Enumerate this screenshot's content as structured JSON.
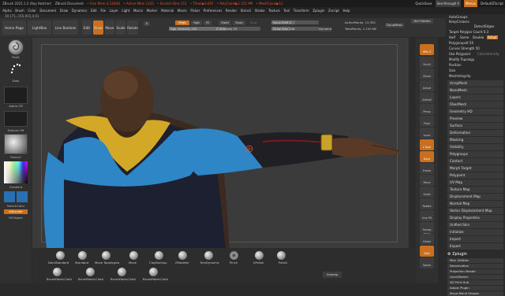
{
  "titlebar": {
    "app": "ZBrush 2021.1.2 (Ray Hatcher)",
    "doc": "ZBrush Document",
    "free_mem": "• Free Mem 4,316GB",
    "active_mem": "• Active Mem 1333",
    "scratch": "• Scratch Disk 211",
    "timer": "• Timer▶0.001",
    "polycount": "• PolyCount▶1.151 MP",
    "meshcount": "• MeshCount▶11",
    "quicksave": "QuickSave",
    "seethrough": "See-through 0",
    "menus": "Menus",
    "script": "DefaultZScript"
  },
  "menubar": [
    "Alpha",
    "Brush",
    "Color",
    "Document",
    "Draw",
    "Dynamics",
    "Edit",
    "File",
    "Layer",
    "Light",
    "Macro",
    "Marker",
    "Material",
    "Movie",
    "Picker",
    "Preferences",
    "Render",
    "Stencil",
    "Stroke",
    "Texture",
    "Tool",
    "Transform",
    "Zplugin",
    "Zscript",
    "Help"
  ],
  "coords": "39.171,-155.915,4.01",
  "toolbar": {
    "home_page": "Home Page",
    "lightbox": "LightBox",
    "live_boolean": "Live Boolean",
    "edit": "Edit",
    "draw": "Draw",
    "move": "Move",
    "scale": "Scale",
    "rotate": "Rotate",
    "a_label": "A",
    "mrgb": "Mrgb",
    "rgb": "Rgb",
    "m": "M",
    "zadd": "Zadd",
    "zsub": "Zsub",
    "zcut": "Zcut",
    "rgb_intensity": "Rgb Intensity 100",
    "z_intensity": "Z Intensity 25",
    "focal_shift": "Focal Shift 0",
    "draw_size": "Draw Size 146",
    "dynamic": "Dynamic",
    "active_points": "ActivePoints: 13,392",
    "total_points": "TotalPoints: 1.150 Mil",
    "dynamesh": "DynaMesh",
    "del_hidden": "Del Hidden"
  },
  "left_shelf": {
    "paint_label": "Paint",
    "dots_label": "Dots",
    "alpha": "Alpha Off",
    "texture": "Texture Off",
    "material": "Fibers2",
    "gradient": "Gradient",
    "switch_color": "SwitchColor",
    "alternate": "Alternate",
    "fill_object": "FillObject"
  },
  "right_shelf": [
    "SPix 3",
    "Scroll",
    "Zoom",
    "Actual",
    "AAHalf",
    "Persp",
    "Floor",
    "Local",
    "L.Sym",
    "Gxyz",
    "Frame",
    "Move",
    "Scale",
    "Rotate",
    "Line Fill PolyF",
    "Transp",
    "Ghost",
    "Solo",
    "Xpose"
  ],
  "right_panel": {
    "top_items": [
      "AutoGroups",
      "KeepCreases",
      "DetectEdges",
      "Target Polygon Count 0.3",
      "Half",
      "Same",
      "Double",
      "Adapt",
      "PolygroupsIt 50",
      "Curves Strength 50",
      "Use Polypaint",
      "ColorIntensity",
      "Modify Topology",
      "Position",
      "Size",
      "MeshIntegrity"
    ],
    "groups": [
      "ArrayMesh",
      "NanoMesh",
      "Layers",
      "FiberMesh",
      "Geometry HD",
      "Preview",
      "Surface",
      "Deformation",
      "Masking",
      "Visibility",
      "Polygroups",
      "Contact",
      "Morph Target",
      "Polypaint",
      "UV Map",
      "Texture Map",
      "Displacement Map",
      "Normal Map",
      "Vector Displacement Map",
      "Display Properties",
      "Unified Skin",
      "Initialize",
      "Import",
      "Export"
    ],
    "zplugin": "Zplugin",
    "plugins": [
      "Misc Utilities",
      "Deactivation",
      "Projection Master",
      "QuickSketch",
      "3D Print Hub",
      "Adjust Plugin",
      "Maya Blend Shapes"
    ]
  },
  "bottom_shelf": {
    "brushes_row1": [
      "DamStandard",
      "Standard",
      "Move Topologica",
      "Move",
      "ClayBuildup",
      "ZModeler",
      "TrimDynamic",
      "Pinch",
      "hPolish",
      "Polish"
    ],
    "brushes_row2": [
      "BrushFabricCloth",
      "BrushFabricCloth",
      "BrushFabricCloth",
      "BrushFabricCloth"
    ],
    "unwrap": "Unwrap"
  },
  "colors": {
    "accent": "#c8701f",
    "panel": "#2b2b2b",
    "viewport": "#3b3b3b",
    "skin": "#5a3a26",
    "shirt_dark": "#1d2030",
    "shirt_blue": "#2f86c6",
    "shirt_yellow": "#d2a826"
  }
}
